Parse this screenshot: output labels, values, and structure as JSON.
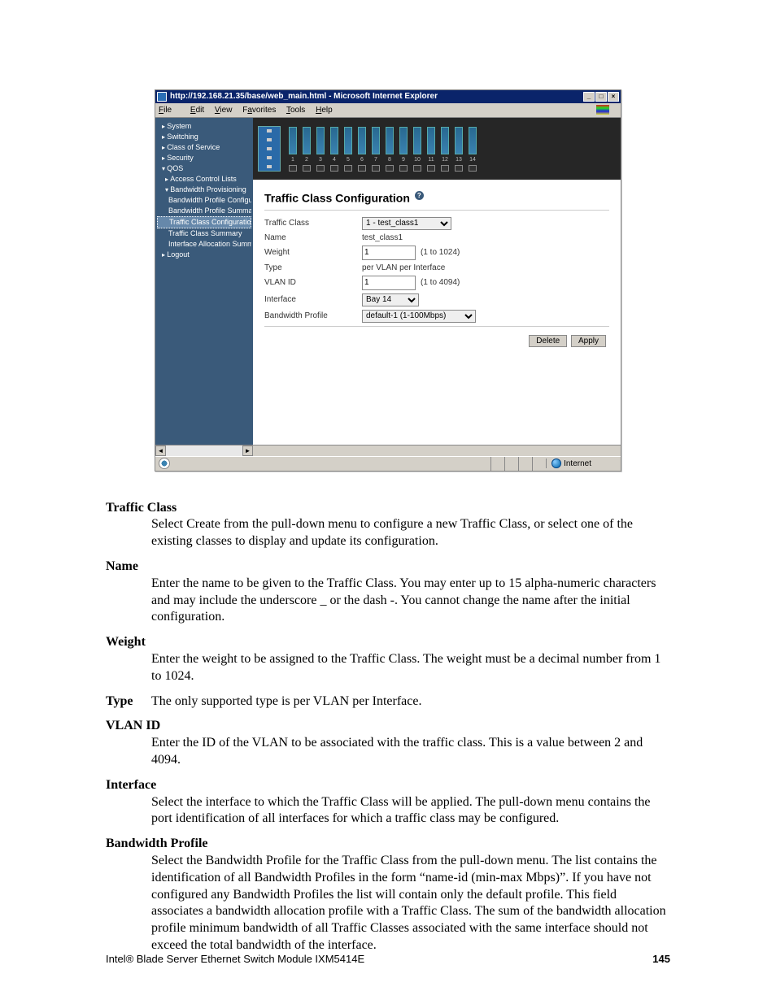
{
  "screenshot": {
    "window_title": "http://192.168.21.35/base/web_main.html - Microsoft Internet Explorer",
    "menubar": [
      "File",
      "Edit",
      "View",
      "Favorites",
      "Tools",
      "Help"
    ],
    "nav": {
      "items": [
        "System",
        "Switching",
        "Class of Service",
        "Security",
        "QOS",
        "Access Control Lists",
        "Bandwidth Provisioning",
        "Bandwidth Profile Configuration",
        "Bandwidth Profile Summary",
        "Traffic Class Configuration",
        "Traffic Class Summary",
        "Interface Allocation Summary",
        "Logout"
      ]
    },
    "port_count": 14,
    "page_heading": "Traffic Class Configuration",
    "help_badge": "?",
    "form": {
      "traffic_class_label": "Traffic Class",
      "traffic_class_value": "1 - test_class1",
      "name_label": "Name",
      "name_value": "test_class1",
      "weight_label": "Weight",
      "weight_value": "1",
      "weight_hint": "(1 to 1024)",
      "type_label": "Type",
      "type_value": "per VLAN per Interface",
      "vlan_label": "VLAN ID",
      "vlan_value": "1",
      "vlan_hint": "(1 to 4094)",
      "interface_label": "Interface",
      "interface_value": "Bay 14",
      "bw_label": "Bandwidth Profile",
      "bw_value": "default-1 (1-100Mbps)"
    },
    "buttons": {
      "delete": "Delete",
      "apply": "Apply"
    },
    "status_zone": "Internet"
  },
  "doc": {
    "traffic_class_t": "Traffic Class",
    "traffic_class_d": "Select Create from the pull-down menu to configure a new Traffic Class, or select one of the existing classes to display and update its configuration.",
    "name_t": "Name",
    "name_d": "Enter the name to be given to the Traffic Class. You may enter up to 15 alpha-numeric characters and may include the underscore _ or the dash -. You cannot change the name after the initial configuration.",
    "weight_t": "Weight",
    "weight_d": "Enter the weight to be assigned to the Traffic Class. The weight must be a decimal number from 1 to 1024.",
    "type_t": "Type",
    "type_d": "The only supported type is per VLAN per Interface.",
    "vlan_t": "VLAN ID",
    "vlan_d": "Enter the ID of the VLAN to be associated with the traffic class. This is a value between 2 and 4094.",
    "interface_t": "Interface",
    "interface_d": "Select the interface to which the Traffic Class will be applied. The pull-down menu contains the port identification of all interfaces for which a traffic class may be configured.",
    "bw_t": "Bandwidth Profile",
    "bw_d": "Select the Bandwidth Profile for the Traffic Class from the pull-down menu. The list contains the identification of all Bandwidth Profiles in the form “name-id (min-max Mbps)”. If you have not configured any Bandwidth Profiles the list will contain only the default profile. This field associates a bandwidth allocation profile with a Traffic Class. The sum of the bandwidth allocation profile minimum bandwidth of all Traffic Classes associated with the same interface should not exceed the total bandwidth of the interface."
  },
  "footer": {
    "product": "Intel® Blade Server Ethernet Switch Module IXM5414E",
    "page": "145"
  }
}
